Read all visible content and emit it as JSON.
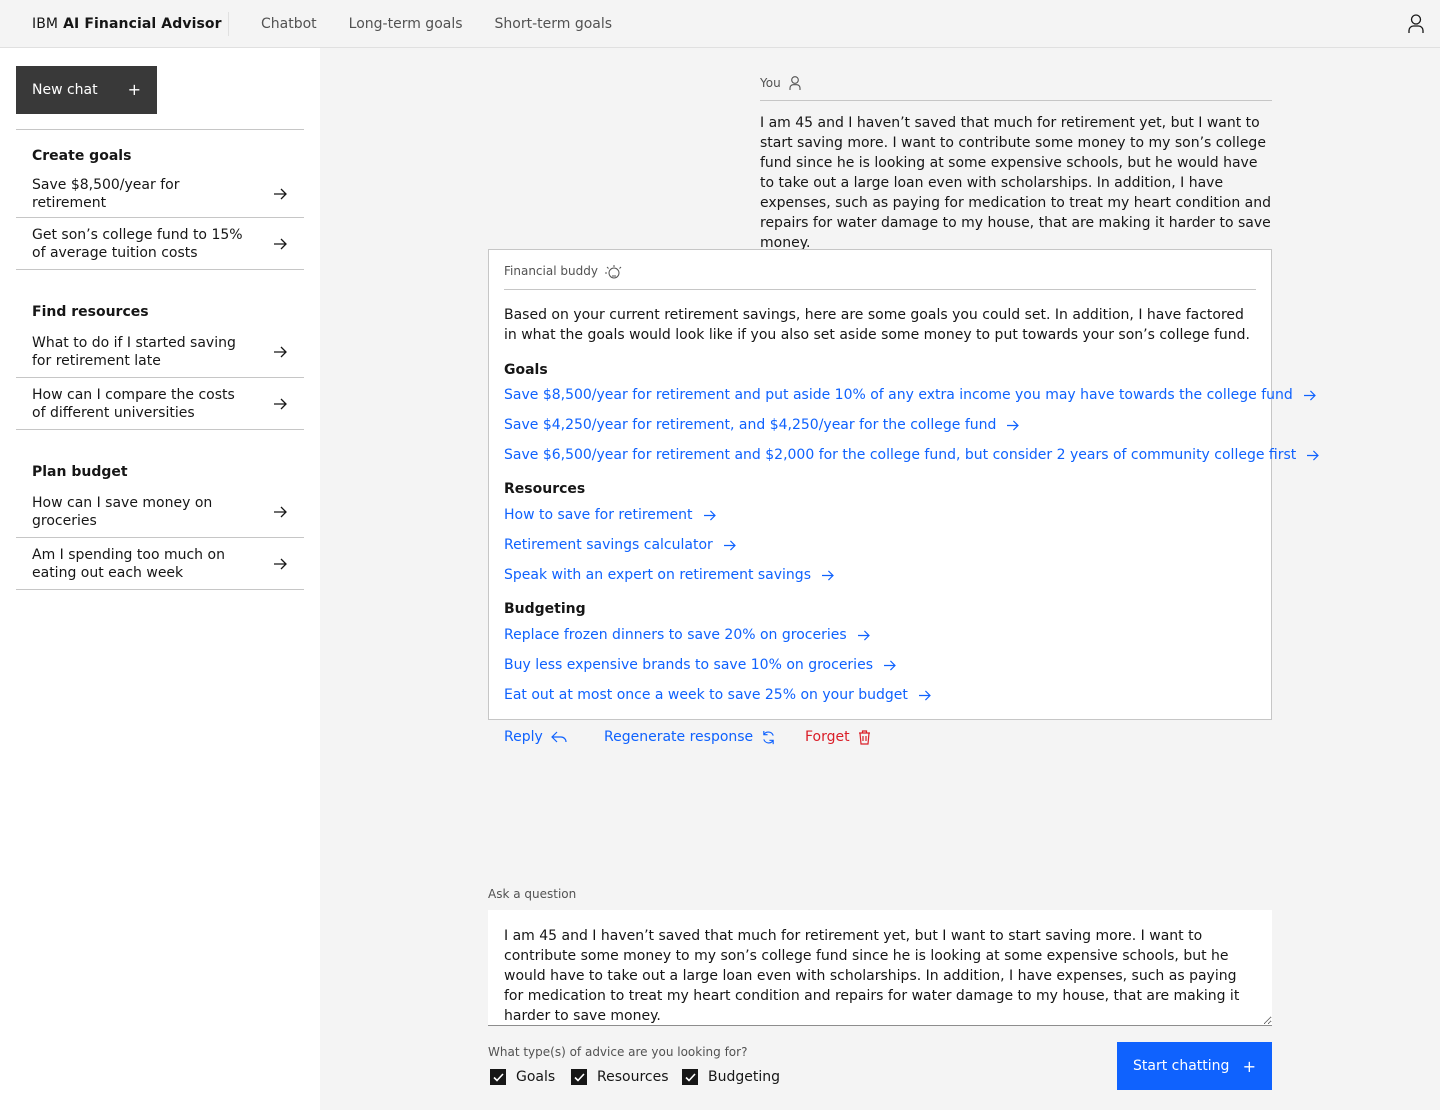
{
  "header": {
    "brand_prefix": "IBM",
    "brand_name": "AI Financial Advisor",
    "nav": [
      "Chatbot",
      "Long-term goals",
      "Short-term goals"
    ]
  },
  "sidebar": {
    "new_chat_label": "New chat",
    "sections": [
      {
        "heading": "Create goals",
        "items": [
          "Save $8,500/year for retirement",
          "Get son’s college fund to 15% of average tuition costs"
        ]
      },
      {
        "heading": "Find resources",
        "items": [
          "What to do if I started saving for retirement late",
          "How can I compare the costs of different universities"
        ]
      },
      {
        "heading": "Plan budget",
        "items": [
          "How can I save money on groceries",
          "Am I spending too much on eating out each week"
        ]
      }
    ]
  },
  "conversation": {
    "user_label": "You",
    "user_message": "I am 45 and I haven’t saved that much for retirement yet, but I want to start saving more. I want to contribute some money to my son’s college fund since he is looking at some expensive schools, but he would have to take out a large loan even with scholarships. In addition, I have expenses, such as paying for medication to treat my heart condition and repairs for water damage to my house, that are making it harder to save money.",
    "bot_label": "Financial buddy",
    "bot_intro": "Based on your current retirement savings, here are some goals you could set. In addition, I have factored in what the goals would look like if you also set aside some money to put towards your son’s college fund.",
    "goals_heading": "Goals",
    "goals": [
      "Save $8,500/year for retirement and put aside 10% of any extra income you may have towards the college fund",
      "Save $4,250/year for retirement, and $4,250/year for the college fund",
      "Save $6,500/year for retirement and $2,000 for the college fund, but consider 2 years of community college first"
    ],
    "resources_heading": "Resources",
    "resources": [
      "How to save for retirement",
      "Retirement savings calculator",
      "Speak with an expert on retirement savings"
    ],
    "budgeting_heading": "Budgeting",
    "budgeting": [
      "Replace frozen dinners to save 20% on groceries",
      "Buy less expensive brands to save 10% on groceries",
      "Eat out at most once a week to save 25% on your budget"
    ],
    "actions": {
      "reply": "Reply",
      "regenerate": "Regenerate response",
      "forget": "Forget"
    }
  },
  "composer": {
    "ask_label": "Ask a question",
    "question_value": "I am 45 and I haven’t saved that much for retirement yet, but I want to start saving more. I want to contribute some money to my son’s college fund since he is looking at some expensive schools, but he would have to take out a large loan even with scholarships. In addition, I have expenses, such as paying for medication to treat my heart condition and repairs for water damage to my house, that are making it harder to save money.",
    "advice_label": "What type(s) of advice are you looking for?",
    "checkboxes": [
      {
        "label": "Goals",
        "checked": true
      },
      {
        "label": "Resources",
        "checked": true
      },
      {
        "label": "Budgeting",
        "checked": true
      }
    ],
    "start_label": "Start chatting"
  },
  "colors": {
    "link": "#0f62fe",
    "danger": "#da1e28",
    "dark_button": "#393939",
    "primary_button": "#0f62fe"
  }
}
